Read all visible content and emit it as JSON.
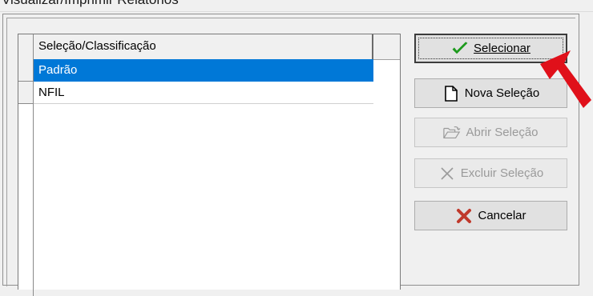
{
  "window": {
    "title": "Visualizar/Imprimir Relatórios"
  },
  "grid": {
    "column_header": "Seleção/Classificação",
    "rows": [
      {
        "label": "Padrão",
        "selected": true
      },
      {
        "label": "NFIL",
        "selected": false
      }
    ]
  },
  "buttons": {
    "select": {
      "label": "Selecionar",
      "enabled": true,
      "icon": "check-icon"
    },
    "new": {
      "label": "Nova Seleção",
      "enabled": true,
      "icon": "new-document-icon"
    },
    "open": {
      "label": "Abrir Seleção",
      "enabled": false,
      "icon": "open-folder-icon"
    },
    "delete": {
      "label": "Excluir Seleção",
      "enabled": false,
      "icon": "x-icon"
    },
    "cancel": {
      "label": "Cancelar",
      "enabled": true,
      "icon": "cancel-x-icon"
    }
  },
  "colors": {
    "selection": "#0078d7",
    "check": "#1d9a1d",
    "cancel": "#c0392b",
    "pointer": "#e0101a"
  }
}
